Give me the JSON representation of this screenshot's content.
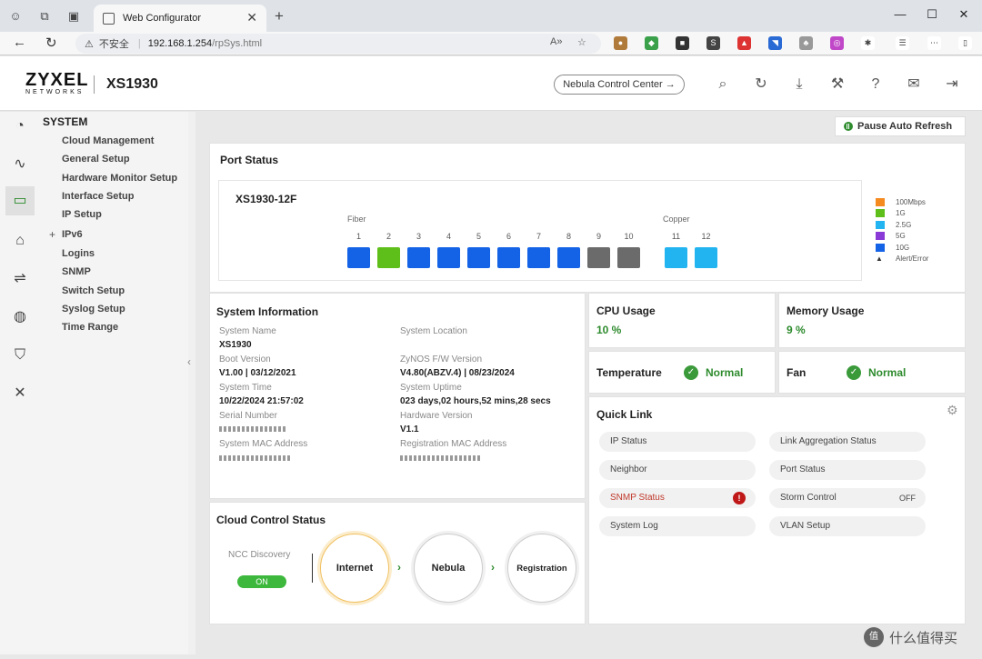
{
  "browser": {
    "tab_title": "Web Configurator",
    "security_label": "不安全",
    "url_host": "192.168.1.254",
    "url_path": "/rpSys.html"
  },
  "header": {
    "logo_main": "ZYXEL",
    "logo_sub": "NETWORKS",
    "model": "XS1930",
    "ncc_button": "Nebula Control Center →"
  },
  "sidebar": {
    "title": "SYSTEM",
    "items": [
      {
        "label": "Cloud Management"
      },
      {
        "label": "General Setup"
      },
      {
        "label": "Hardware Monitor Setup"
      },
      {
        "label": "Interface Setup"
      },
      {
        "label": "IP Setup"
      },
      {
        "label": "IPv6"
      },
      {
        "label": "Logins"
      },
      {
        "label": "SNMP"
      },
      {
        "label": "Switch Setup"
      },
      {
        "label": "Syslog Setup"
      },
      {
        "label": "Time Range"
      }
    ]
  },
  "main": {
    "pause_button": "Pause Auto Refresh"
  },
  "port_status": {
    "title": "Port Status",
    "device": "XS1930-12F",
    "fiber_label": "Fiber",
    "copper_label": "Copper",
    "ports": [
      {
        "num": "1",
        "color": "#1463e6"
      },
      {
        "num": "2",
        "color": "#5fbf1a"
      },
      {
        "num": "3",
        "color": "#1463e6"
      },
      {
        "num": "4",
        "color": "#1463e6"
      },
      {
        "num": "5",
        "color": "#1463e6"
      },
      {
        "num": "6",
        "color": "#1463e6"
      },
      {
        "num": "7",
        "color": "#1463e6"
      },
      {
        "num": "8",
        "color": "#1463e6"
      },
      {
        "num": "9",
        "color": "#6b6b6b"
      },
      {
        "num": "10",
        "color": "#6b6b6b"
      },
      {
        "num": "11",
        "color": "#22b4f0"
      },
      {
        "num": "12",
        "color": "#22b4f0"
      }
    ],
    "legend": [
      {
        "label": "100Mbps",
        "color": "#f58a1f"
      },
      {
        "label": "1G",
        "color": "#5fbf1a"
      },
      {
        "label": "2.5G",
        "color": "#22b4f0"
      },
      {
        "label": "5G",
        "color": "#8a3ad6"
      },
      {
        "label": "10G",
        "color": "#1463e6"
      },
      {
        "label": "Alert/Error",
        "color": ""
      }
    ]
  },
  "system_info": {
    "title": "System Information",
    "system_name_label": "System Name",
    "system_name": "XS1930",
    "system_location_label": "System Location",
    "system_location": "",
    "boot_version_label": "Boot Version",
    "boot_version": "V1.00 | 03/12/2021",
    "fw_version_label": "ZyNOS F/W Version",
    "fw_version": "V4.80(ABZV.4) | 08/23/2024",
    "system_time_label": "System Time",
    "system_time": "10/22/2024 21:57:02",
    "uptime_label": "System Uptime",
    "uptime": "023 days,02 hours,52 mins,28 secs",
    "serial_label": "Serial Number",
    "hw_version_label": "Hardware Version",
    "hw_version": "V1.1",
    "mac_label": "System MAC Address",
    "reg_mac_label": "Registration MAC Address"
  },
  "cpu": {
    "title": "CPU Usage",
    "value": "10 %"
  },
  "memory": {
    "title": "Memory Usage",
    "value": "9 %"
  },
  "temperature": {
    "title": "Temperature",
    "status": "Normal"
  },
  "fan": {
    "title": "Fan",
    "status": "Normal"
  },
  "quick_link": {
    "title": "Quick Link",
    "links": [
      {
        "label": "IP Status"
      },
      {
        "label": "Link Aggregation Status"
      },
      {
        "label": "Neighbor"
      },
      {
        "label": "Port Status"
      },
      {
        "label": "SNMP Status"
      },
      {
        "label": "Storm Control",
        "extra": "OFF"
      },
      {
        "label": "System Log"
      },
      {
        "label": "VLAN Setup"
      }
    ]
  },
  "cloud": {
    "title": "Cloud Control Status",
    "ncc_discovery_label": "NCC Discovery",
    "toggle": "ON",
    "steps": [
      "Internet",
      "Nebula",
      "Registration"
    ]
  },
  "watermark": {
    "text": "什么值得买",
    "logo": "值"
  }
}
